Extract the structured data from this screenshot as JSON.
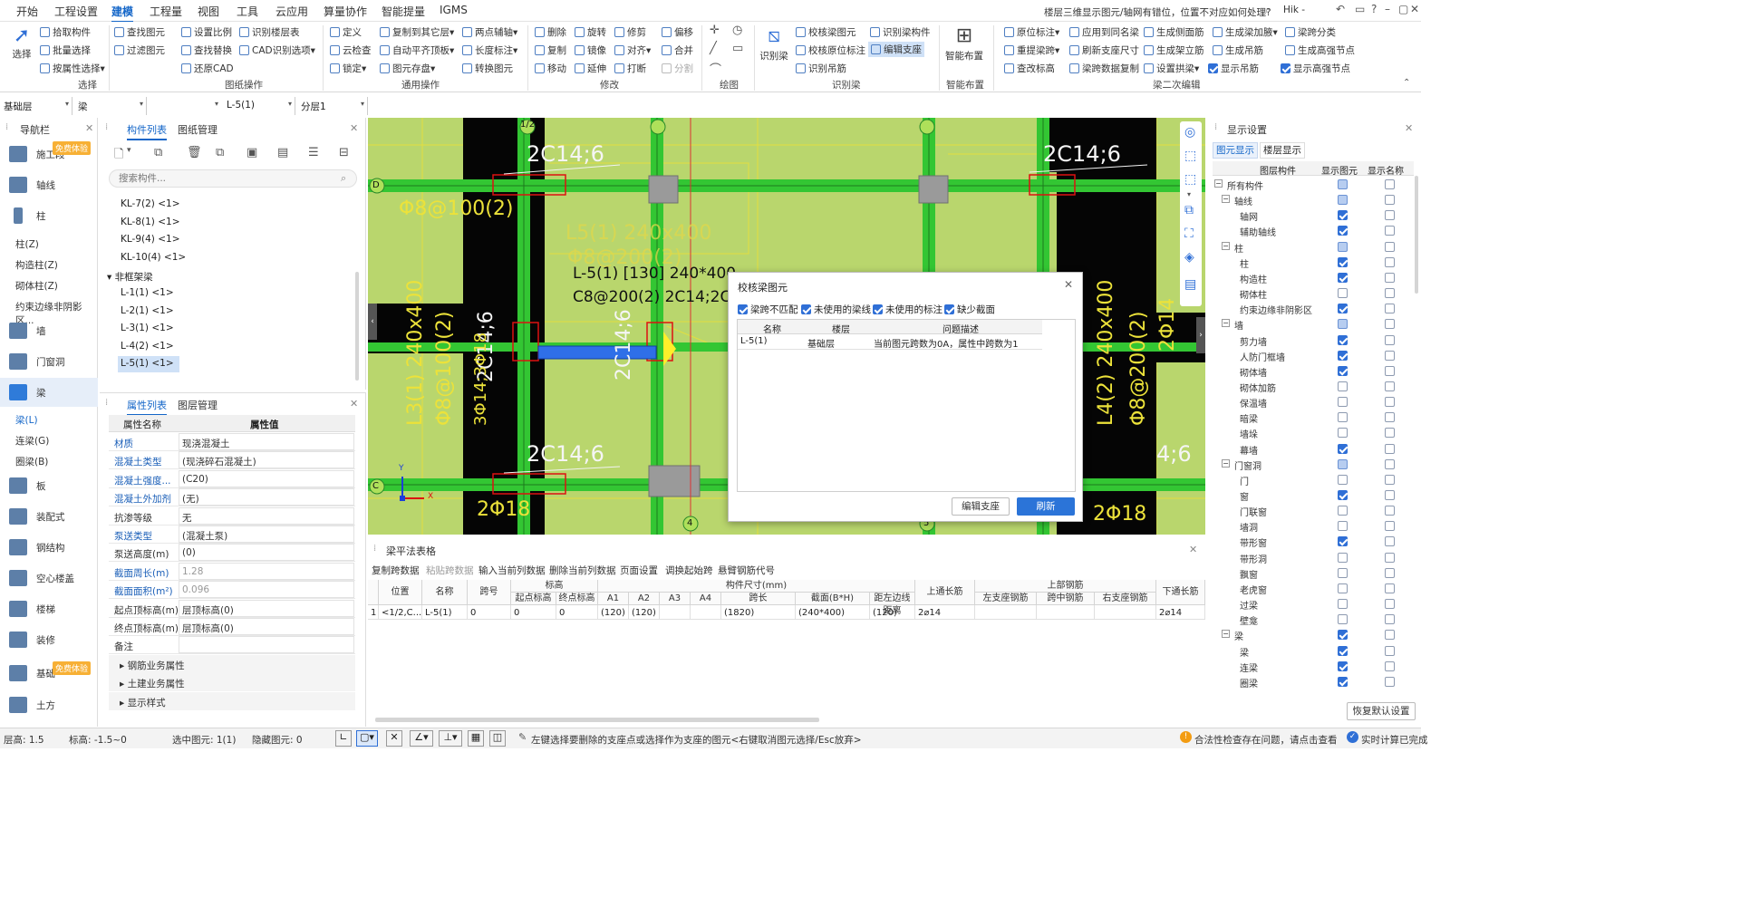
{
  "menu": [
    "开始",
    "工程设置",
    "建模",
    "工程量",
    "视图",
    "工具",
    "云应用",
    "算量协作",
    "智能提量",
    "IGMS"
  ],
  "menu_active": "建模",
  "notice": "楼层三维显示图元/轴网有错位，位置不对应如何处理?",
  "user": "Hik -",
  "ribbon": {
    "select_label": "选择",
    "select_group": [
      "拾取构件",
      "批量选择",
      "按属性选择"
    ],
    "group_select": "选择",
    "drawing_ops": [
      "查找图元",
      "过滤图元",
      "设置比例",
      "查找替换",
      "还原CAD",
      "识别楼层表",
      "CAD识别选项"
    ],
    "group_drawing": "图纸操作",
    "general_ops": [
      "定义",
      "云检查",
      "锁定",
      "复制到其它层",
      "自动平齐顶板",
      "图元存盘",
      "两点辅轴",
      "长度标注",
      "转换图元"
    ],
    "group_general": "通用操作",
    "modify_ops": [
      "删除",
      "旋转",
      "修剪",
      "偏移",
      "复制",
      "镜像",
      "对齐",
      "合并",
      "移动",
      "延伸",
      "打断",
      "分割"
    ],
    "group_modify": "修改",
    "group_draw": "绘图",
    "recognize_label": "识别梁",
    "recognize_ops": [
      "校核梁图元",
      "识别梁构件",
      "校核原位标注",
      "编辑支座",
      "识别吊筋"
    ],
    "group_recognize": "识别梁",
    "smart_label": "智能布置",
    "group_smart": "智能布置",
    "secondary_ops": [
      "原位标注",
      "应用到同名梁",
      "生成侧面筋",
      "生成梁加腋",
      "梁跨分类",
      "重提梁跨",
      "刷新支座尺寸",
      "生成架立筋",
      "生成吊筋",
      "生成高强节点",
      "查改标高",
      "梁跨数据复制",
      "设置拱梁",
      "显示吊筋",
      "显示高强节点"
    ],
    "group_secondary": "梁二次编辑"
  },
  "selectors": [
    "基础层",
    "梁",
    "L-5(1)",
    "分层1"
  ],
  "nav": {
    "title": "导航栏",
    "trial_badge": "免费体验",
    "items": [
      "施工段",
      "轴线",
      "柱",
      "墙",
      "门窗洞",
      "梁",
      "板",
      "装配式",
      "钢结构",
      "空心楼盖",
      "楼梯",
      "装修",
      "基础",
      "土方"
    ],
    "column_sub": [
      "柱(Z)",
      "构造柱(Z)",
      "砌体柱(Z)",
      "约束边缘非阴影区..."
    ],
    "beam_sub": [
      "梁(L)",
      "连梁(G)",
      "圈梁(B)"
    ]
  },
  "components": {
    "tab_list": "构件列表",
    "tab_drawings": "图纸管理",
    "search_placeholder": "搜索构件...",
    "items": [
      "KL-7(2) <1>",
      "KL-8(1) <1>",
      "KL-9(4) <1>",
      "KL-10(4) <1>"
    ],
    "group_nonframe": "非框架梁",
    "nonframe_items": [
      "L-1(1) <1>",
      "L-2(1) <1>",
      "L-3(1) <1>",
      "L-4(2) <1>",
      "L-5(1) <1>"
    ]
  },
  "properties": {
    "tab_props": "属性列表",
    "tab_layers": "图层管理",
    "col_name": "属性名称",
    "col_value": "属性值",
    "rows": [
      {
        "name": "材质",
        "value": "现浇混凝土",
        "blue": true,
        "grey": false
      },
      {
        "name": "混凝土类型",
        "value": "(现浇碎石混凝土)",
        "blue": true,
        "grey": false
      },
      {
        "name": "混凝土强度...",
        "value": "(C20)",
        "blue": true,
        "grey": false
      },
      {
        "name": "混凝土外加剂",
        "value": "(无)",
        "blue": true,
        "grey": false
      },
      {
        "name": "抗渗等级",
        "value": "无",
        "blue": false,
        "grey": false
      },
      {
        "name": "泵送类型",
        "value": "(混凝土泵)",
        "blue": true,
        "grey": false
      },
      {
        "name": "泵送高度(m)",
        "value": "(0)",
        "blue": false,
        "grey": false
      },
      {
        "name": "截面周长(m)",
        "value": "1.28",
        "blue": true,
        "grey": true
      },
      {
        "name": "截面面积(m²)",
        "value": "0.096",
        "blue": true,
        "grey": true
      },
      {
        "name": "起点顶标高(m)",
        "value": "层顶标高(0)",
        "blue": false,
        "grey": false
      },
      {
        "name": "终点顶标高(m)",
        "value": "层顶标高(0)",
        "blue": false,
        "grey": false
      },
      {
        "name": "备注",
        "value": "",
        "blue": false,
        "grey": false
      }
    ],
    "groups": [
      "钢筋业务属性",
      "土建业务属性",
      "显示样式"
    ]
  },
  "canvas": {
    "labels": [
      "2C14;6",
      "2C14;6",
      "2C14;6",
      "4;6",
      "Φ8@100(2)",
      "L5(1) 240x400",
      "Φ8@200(2)",
      "L-5(1) [130] 240*400",
      "C8@200(2) 2C14;2C1",
      "2C14;6",
      "2C14;6",
      "3Φ14;3Φ18",
      "L3(1) 240x400",
      "Φ8@100(2)",
      "L4(2) 240x400",
      "Φ8@200(2)",
      "2Φ14",
      "2Φ18",
      "2Φ18",
      "1/2",
      "D",
      "C",
      "4",
      "5",
      "X",
      "Y"
    ]
  },
  "dialog": {
    "title": "校核梁图元",
    "checks": [
      "梁跨不匹配",
      "未使用的梁线",
      "未使用的标注",
      "缺少截面"
    ],
    "cols": [
      "名称",
      "楼层",
      "问题描述"
    ],
    "row": [
      "L-5(1)",
      "基础层",
      "当前图元跨数为0A，属性中跨数为1"
    ],
    "btn_edit": "编辑支座",
    "btn_refresh": "刷新"
  },
  "display": {
    "title": "显示设置",
    "tab1": "图元显示",
    "tab2": "楼层显示",
    "col1": "图层构件",
    "col2": "显示图元",
    "col3": "显示名称",
    "rows": [
      {
        "name": "所有构件",
        "lvl": 0,
        "sh": "part",
        "nm": "off"
      },
      {
        "name": "轴线",
        "lvl": 1,
        "sh": "part",
        "nm": "off"
      },
      {
        "name": "轴网",
        "lvl": 2,
        "sh": "on",
        "nm": "off"
      },
      {
        "name": "辅助轴线",
        "lvl": 2,
        "sh": "on",
        "nm": "off"
      },
      {
        "name": "柱",
        "lvl": 1,
        "sh": "part",
        "nm": "off"
      },
      {
        "name": "柱",
        "lvl": 2,
        "sh": "on",
        "nm": "off"
      },
      {
        "name": "构造柱",
        "lvl": 2,
        "sh": "on",
        "nm": "off"
      },
      {
        "name": "砌体柱",
        "lvl": 2,
        "sh": "off",
        "nm": "off"
      },
      {
        "name": "约束边缘非阴影区",
        "lvl": 2,
        "sh": "on",
        "nm": "off"
      },
      {
        "name": "墙",
        "lvl": 1,
        "sh": "part",
        "nm": "off"
      },
      {
        "name": "剪力墙",
        "lvl": 2,
        "sh": "on",
        "nm": "off"
      },
      {
        "name": "人防门框墙",
        "lvl": 2,
        "sh": "on",
        "nm": "off"
      },
      {
        "name": "砌体墙",
        "lvl": 2,
        "sh": "on",
        "nm": "off"
      },
      {
        "name": "砌体加筋",
        "lvl": 2,
        "sh": "off",
        "nm": "off"
      },
      {
        "name": "保温墙",
        "lvl": 2,
        "sh": "off",
        "nm": "off"
      },
      {
        "name": "暗梁",
        "lvl": 2,
        "sh": "off",
        "nm": "off"
      },
      {
        "name": "墙垛",
        "lvl": 2,
        "sh": "off",
        "nm": "off"
      },
      {
        "name": "幕墙",
        "lvl": 2,
        "sh": "on",
        "nm": "off"
      },
      {
        "name": "门窗洞",
        "lvl": 1,
        "sh": "part",
        "nm": "off"
      },
      {
        "name": "门",
        "lvl": 2,
        "sh": "off",
        "nm": "off"
      },
      {
        "name": "窗",
        "lvl": 2,
        "sh": "on",
        "nm": "off"
      },
      {
        "name": "门联窗",
        "lvl": 2,
        "sh": "off",
        "nm": "off"
      },
      {
        "name": "墙洞",
        "lvl": 2,
        "sh": "off",
        "nm": "off"
      },
      {
        "name": "带形窗",
        "lvl": 2,
        "sh": "on",
        "nm": "off"
      },
      {
        "name": "带形洞",
        "lvl": 2,
        "sh": "off",
        "nm": "off"
      },
      {
        "name": "飘窗",
        "lvl": 2,
        "sh": "off",
        "nm": "off"
      },
      {
        "name": "老虎窗",
        "lvl": 2,
        "sh": "off",
        "nm": "off"
      },
      {
        "name": "过梁",
        "lvl": 2,
        "sh": "off",
        "nm": "off"
      },
      {
        "name": "壁龛",
        "lvl": 2,
        "sh": "off",
        "nm": "off"
      },
      {
        "name": "梁",
        "lvl": 1,
        "sh": "on",
        "nm": "off"
      },
      {
        "name": "梁",
        "lvl": 2,
        "sh": "on",
        "nm": "off"
      },
      {
        "name": "连梁",
        "lvl": 2,
        "sh": "on",
        "nm": "off"
      },
      {
        "name": "圈梁",
        "lvl": 2,
        "sh": "on",
        "nm": "off"
      }
    ],
    "restore_btn": "恢复默认设置"
  },
  "beamtable": {
    "title": "梁平法表格",
    "toolbar": [
      "复制跨数据",
      "粘贴跨数据",
      "输入当前列数据",
      "删除当前列数据",
      "页面设置",
      "调换起始跨",
      "悬臂钢筋代号"
    ],
    "h_top": [
      "位置",
      "名称",
      "跨号",
      "标高",
      "构件尺寸(mm)",
      "上通长筋",
      "上部钢筋",
      "下通长筋"
    ],
    "h_sub": [
      "起点标高",
      "终点标高",
      "A1",
      "A2",
      "A3",
      "A4",
      "跨长",
      "截面(B*H)",
      "距左边线距离",
      "左支座钢筋",
      "跨中钢筋",
      "右支座钢筋"
    ],
    "row": [
      "1",
      "<1/2,C...",
      "L-5(1)",
      "0",
      "0",
      "0",
      "(120)",
      "(120)",
      "",
      "",
      "(1820)",
      "(240*400)",
      "(120)",
      "2⌀14",
      "",
      "",
      "",
      "2⌀14"
    ]
  },
  "status": {
    "floor_h": "层高:  1.5",
    "elev": "标高:  -1.5~0",
    "selected": "选中图元:  1(1)",
    "hidden": "隐藏图元:  0",
    "hint": "左键选择要删除的支座点或选择作为支座的图元<右键取消图元选择/Esc放弃>",
    "warn": "合法性检查存在问题，请点击查看",
    "done": "实时计算已完成"
  }
}
